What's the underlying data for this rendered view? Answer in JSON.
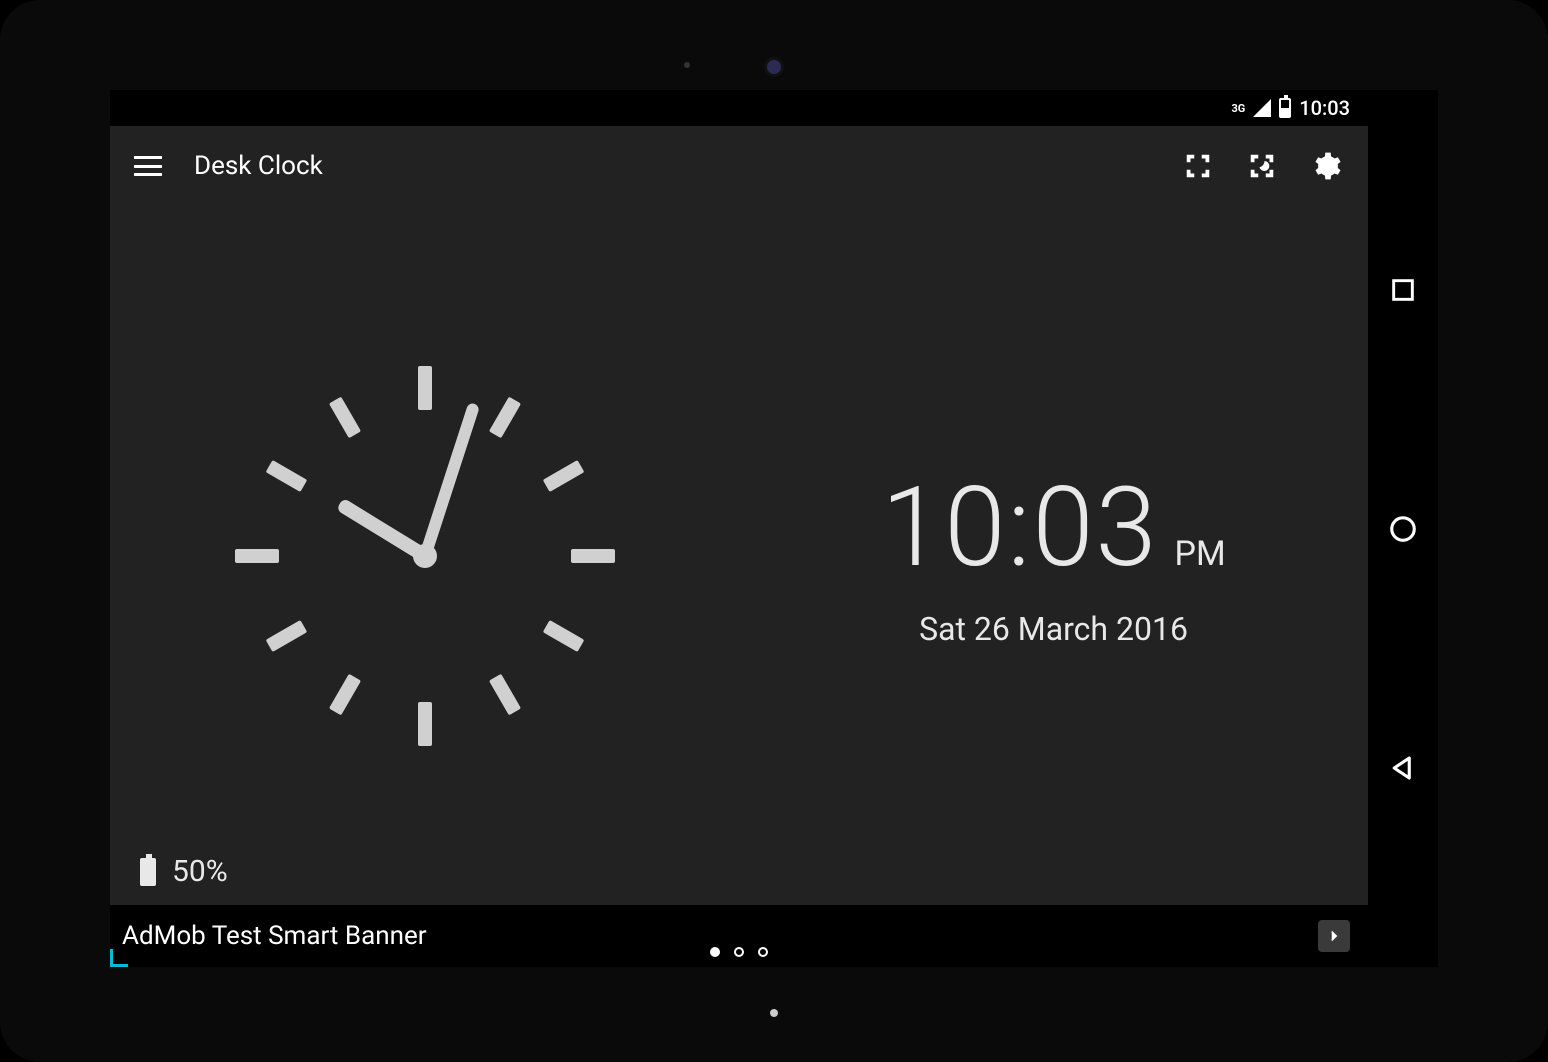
{
  "status_bar": {
    "network": "3G",
    "time": "10:03"
  },
  "app_bar": {
    "title": "Desk Clock",
    "actions": [
      "fullscreen",
      "night-mode",
      "settings"
    ]
  },
  "clock": {
    "digital_time": "10:03",
    "ampm": "PM",
    "date": "Sat 26 March 2016",
    "hour_angle": 301.5,
    "minute_angle": 18
  },
  "battery": {
    "percent_label": "50%"
  },
  "ad": {
    "text": "AdMob Test Smart Banner",
    "page_count": 3,
    "active_page": 0
  }
}
